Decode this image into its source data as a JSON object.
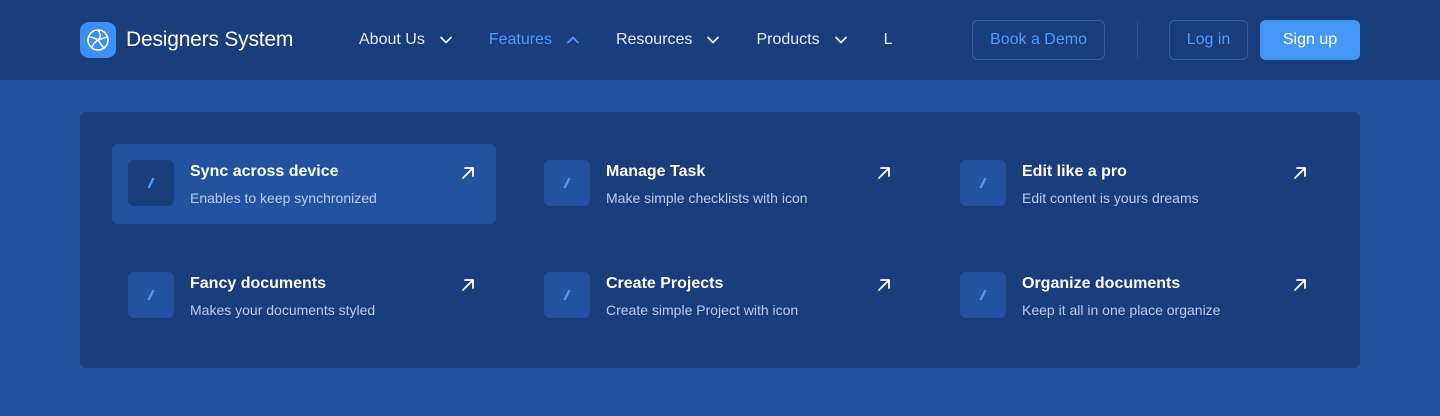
{
  "brand": {
    "name": "Designers System",
    "logo_icon": "aperture-icon"
  },
  "nav": {
    "items": [
      {
        "label": "About Us",
        "chevron": "chevron-down-icon",
        "active": false
      },
      {
        "label": "Features",
        "chevron": "chevron-up-icon",
        "active": true
      },
      {
        "label": "Resources",
        "chevron": "chevron-down-icon",
        "active": false
      },
      {
        "label": "Products",
        "chevron": "chevron-down-icon",
        "active": false
      },
      {
        "label": "L",
        "chevron": "",
        "active": false
      }
    ]
  },
  "actions": {
    "demo_label": "Book a Demo",
    "login_label": "Log in",
    "signup_label": "Sign up"
  },
  "features": {
    "items": [
      {
        "title": "Sync across device",
        "description": "Enables to keep synchronized",
        "icon": "pen-icon",
        "arrow": "arrow-up-right-icon"
      },
      {
        "title": "Manage Task",
        "description": "Make simple checklists with icon",
        "icon": "pen-icon",
        "arrow": "arrow-up-right-icon"
      },
      {
        "title": "Edit like a pro",
        "description": "Edit content is yours dreams",
        "icon": "pen-icon",
        "arrow": "arrow-up-right-icon"
      },
      {
        "title": "Fancy documents",
        "description": "Makes your documents styled",
        "icon": "pen-icon",
        "arrow": "arrow-up-right-icon"
      },
      {
        "title": "Create Projects",
        "description": "Create simple Project with icon",
        "icon": "pen-icon",
        "arrow": "arrow-up-right-icon"
      },
      {
        "title": "Organize documents",
        "description": "Keep it all in one place organize",
        "icon": "pen-icon",
        "arrow": "arrow-up-right-icon"
      }
    ]
  },
  "colors": {
    "page_bg": "#2352a0",
    "bar_bg": "#1a3d7c",
    "accent": "#4d9bff",
    "primary_button": "#4597f5",
    "muted_text": "#b9cbe9"
  }
}
